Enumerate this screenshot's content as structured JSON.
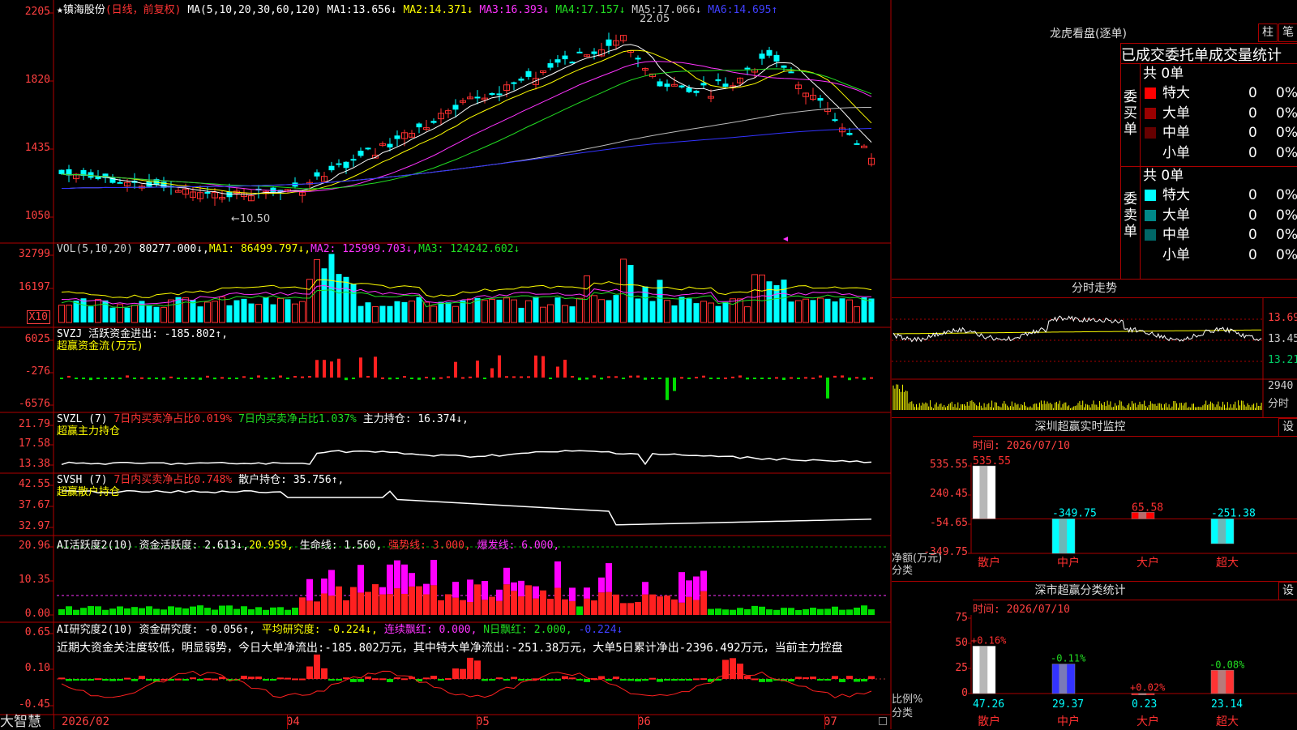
{
  "app": {
    "brand": "大智慧"
  },
  "header": {
    "star": "★",
    "stock_name": "镇海股份",
    "period": "(日线，前复权)",
    "ma_label": "MA(5,10,20,30,60,120)",
    "ma": [
      {
        "label": "MA1:",
        "value": "13.656↓",
        "color": "#ffffff"
      },
      {
        "label": "MA2:",
        "value": "14.371↓",
        "color": "#ffff00"
      },
      {
        "label": "MA3:",
        "value": "16.393↓",
        "color": "#ff33ff"
      },
      {
        "label": "MA4:",
        "value": "17.157↓",
        "color": "#22dd22"
      },
      {
        "label": "MA5:",
        "value": "17.066↓",
        "color": "#cccccc"
      },
      {
        "label": "MA6:",
        "value": "14.695↑",
        "color": "#4040ff"
      }
    ]
  },
  "price_panel": {
    "yticks": [
      "2205",
      "1820",
      "1435",
      "1050"
    ],
    "high_label": "22.05",
    "low_label": "←10.50"
  },
  "volume_panel": {
    "title": "VOL(5,10,20)",
    "value": "80277.000↓,",
    "ma": [
      {
        "label": "MA1:",
        "value": "86499.797↓,",
        "color": "#ffff00"
      },
      {
        "label": "MA2:",
        "value": "125999.703↓,",
        "color": "#ff33ff"
      },
      {
        "label": "MA3:",
        "value": "124242.602↓",
        "color": "#22dd22"
      }
    ],
    "yticks": [
      "32799",
      "16197"
    ],
    "unit": "X10"
  },
  "svzj_panel": {
    "line1": "SVZJ  活跃资金进出: -185.802↑,",
    "line2": "超赢资金流(万元)",
    "yticks": [
      "6025",
      "-276",
      "-6576"
    ]
  },
  "svzl_panel": {
    "p1": "SVZL (7)",
    "p2": "7日内买卖净占比0.019%",
    "p3": "7日内买卖净占比1.037%",
    "p4": "主力持仓: 16.374↓,",
    "line2": "超赢主力持仓",
    "yticks": [
      "21.79",
      "17.58",
      "13.38"
    ]
  },
  "svsh_panel": {
    "p1": "SVSH (7)",
    "p2": "7日内买卖净占比0.748%",
    "p3": "散户持仓: 35.756↑,",
    "line2": "超赢散户持仓",
    "yticks": [
      "42.55",
      "37.67",
      "32.97"
    ]
  },
  "ai_panel": {
    "p1": "AI活跃度2(10)",
    "p2": "资金活跃度: 2.613↓,",
    "p3": "20.959,",
    "p4": "生命线: 1.560,",
    "p5": "强势线: 3.000,",
    "p6": "爆发线: 6.000,",
    "yticks": [
      "20.96",
      "10.35",
      "0.00"
    ]
  },
  "ai_research_panel": {
    "p1": "AI研究度2(10)",
    "p2": "资金研究度: -0.056↑,",
    "p3": "平均研究度: -0.224↓,",
    "p4": "连续飘红: 0.000,",
    "p5": "N日飘红: 2.000,",
    "p6": "-0.224↓",
    "comment": "近期大资金关注度较低，明显弱势，今日大单净流出:-185.802万元，其中特大单净流出:-251.38万元，大单5日累计净出-2396.492万元，当前主力控盘",
    "yticks": [
      "0.65",
      "0.10",
      "-0.45"
    ]
  },
  "xaxis": {
    "labels": [
      "2026/02",
      "04",
      "05",
      "06",
      "07"
    ]
  },
  "longhu": {
    "title": "龙虎看盘(逐单)",
    "btn_bar": "柱",
    "btn_pen": "笔",
    "stats_header": "已成交委托单成交量统计",
    "buy_label": "委买单",
    "sell_label": "委卖单",
    "buy_total": "共 0单",
    "sell_total": "共 0单",
    "buy_rows": [
      {
        "name": "特大",
        "count": "0",
        "pct": "0%",
        "color": "#ff0000"
      },
      {
        "name": "大单",
        "count": "0",
        "pct": "0%",
        "color": "#990000"
      },
      {
        "name": "中单",
        "count": "0",
        "pct": "0%",
        "color": "#660000"
      },
      {
        "name": "小单",
        "count": "0",
        "pct": "0%",
        "color": "#000000"
      }
    ],
    "sell_rows": [
      {
        "name": "特大",
        "count": "0",
        "pct": "0%",
        "color": "#00ffff"
      },
      {
        "name": "大单",
        "count": "0",
        "pct": "0%",
        "color": "#008888"
      },
      {
        "name": "中单",
        "count": "0",
        "pct": "0%",
        "color": "#006666"
      },
      {
        "name": "小单",
        "count": "0",
        "pct": "0%",
        "color": "#000000"
      }
    ]
  },
  "intraday": {
    "title": "分时走势",
    "yticks": [
      "13.69",
      "13.45",
      "13.21"
    ],
    "vol_tick": "2940",
    "vol_label": "分时"
  },
  "monitor": {
    "title": "深圳超赢实时监控",
    "btn": "设",
    "time": "时间: 2026/07/10",
    "yticks": [
      "535.55",
      "240.45",
      "-54.65",
      "-349.75"
    ],
    "axis_label1": "净额(万元)",
    "axis_label2": "分类"
  },
  "classify": {
    "title": "深市超赢分类统计",
    "btn": "设",
    "time": "时间: 2026/07/10",
    "yticks": [
      "75",
      "50",
      "25",
      "0"
    ],
    "axis_label1": "比例%",
    "axis_label2": "分类"
  },
  "chart_data": [
    {
      "type": "bar",
      "title": "深圳超赢实时监控",
      "ylabel": "净额(万元)",
      "xlabel": "分类",
      "categories": [
        "散户",
        "中户",
        "大户",
        "超大"
      ],
      "values": [
        535.55,
        -349.75,
        65.58,
        -251.38
      ],
      "value_labels": [
        "535.55",
        "-349.75",
        "65.58",
        "-251.38"
      ],
      "ylim": [
        -349.75,
        535.55
      ],
      "colors": [
        "#ffffff",
        "#00ffff",
        "#ff0000",
        "#00ffff"
      ]
    },
    {
      "type": "bar",
      "title": "深市超赢分类统计",
      "ylabel": "比例%",
      "xlabel": "分类",
      "categories": [
        "散户",
        "中户",
        "大户",
        "超大"
      ],
      "values": [
        47.26,
        29.37,
        0.23,
        23.14
      ],
      "value_labels": [
        "47.26",
        "29.37",
        "0.23",
        "23.14"
      ],
      "change_labels": [
        "+0.16%",
        "-0.11%",
        "+0.02%",
        "-0.08%"
      ],
      "ylim": [
        0,
        75
      ],
      "colors": [
        "#ffffff",
        "#3333ff",
        "#ff0000",
        "#ff3333"
      ]
    }
  ]
}
